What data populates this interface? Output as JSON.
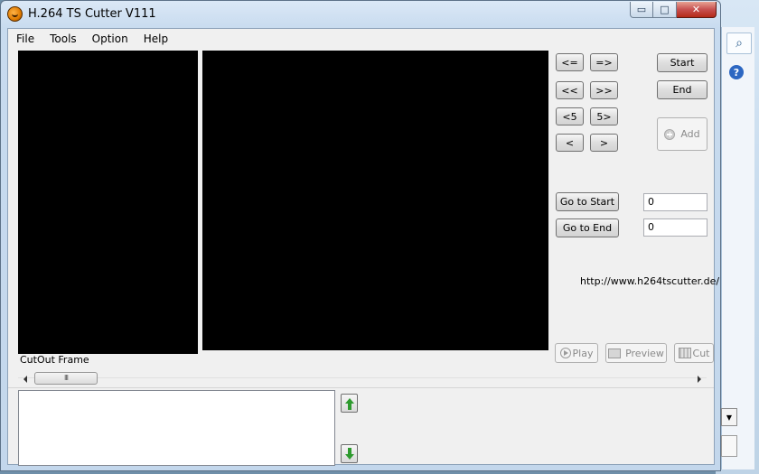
{
  "window": {
    "title": "H.264 TS Cutter V111",
    "minimize_glyph": "▭",
    "maximize_glyph": "□",
    "close_glyph": "✕"
  },
  "menu": {
    "items": [
      {
        "label": "File"
      },
      {
        "label": "Tools"
      },
      {
        "label": "Option"
      },
      {
        "label": "Help"
      }
    ]
  },
  "labels": {
    "cutout_frame": "CutOut Frame",
    "url": "http://www.h264tscutter.de/"
  },
  "nav_buttons": {
    "prev_frame": "<=",
    "next_frame": "=>",
    "rewind": "<<",
    "fast_forward": ">>",
    "back_5": "<5",
    "forward_5": "5>",
    "step_back": "<",
    "step_forward": ">"
  },
  "marker_buttons": {
    "start": "Start",
    "end": "End",
    "add": "Add"
  },
  "goto": {
    "start_label": "Go to Start",
    "start_value": "0",
    "end_label": "Go to End",
    "end_value": "0"
  },
  "playback": {
    "play": "Play",
    "preview": "Preview",
    "cut": "Cut"
  },
  "scrollbar": {
    "thumb_grip": "III"
  },
  "background": {
    "search_glyph": "⌕",
    "help_glyph": "?",
    "dropdown_glyph": "▼"
  }
}
